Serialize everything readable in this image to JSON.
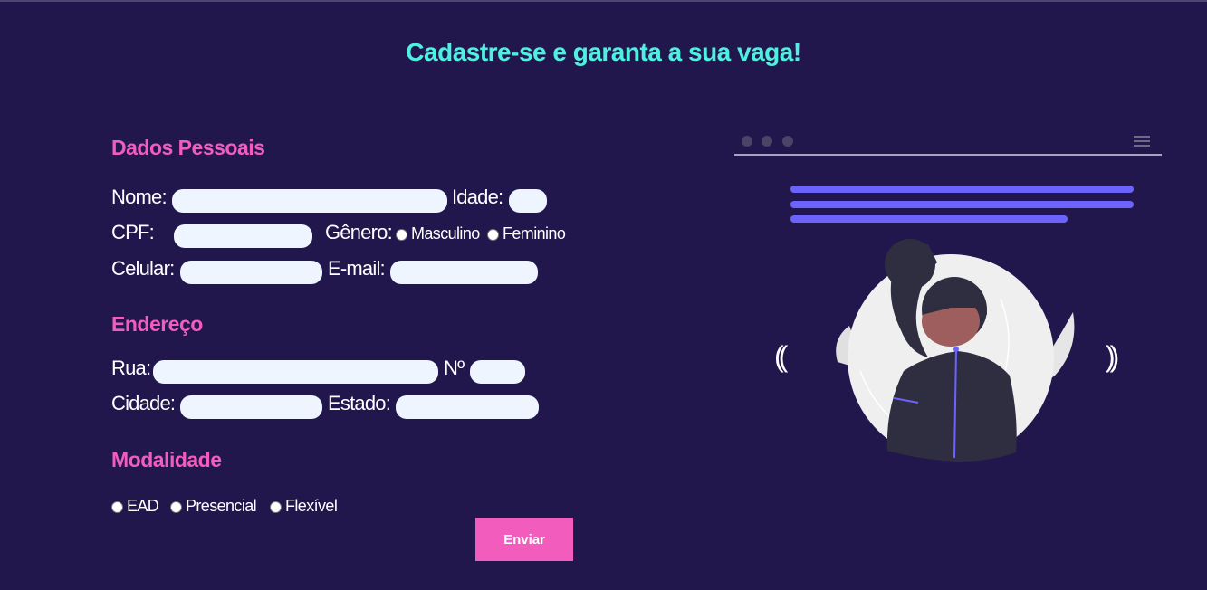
{
  "header": {
    "title": "Cadastre-se e garanta a sua vaga!"
  },
  "sections": {
    "personal": "Dados Pessoais",
    "address": "Endereço",
    "modality": "Modalidade"
  },
  "labels": {
    "nome": "Nome:",
    "idade": "Idade:",
    "cpf": "CPF:",
    "genero": "Gênero:",
    "celular": "Celular:",
    "email": "E-mail:",
    "rua": "Rua:",
    "numero": "Nº",
    "cidade": "Cidade:",
    "estado": "Estado:"
  },
  "gender_options": [
    "Masculino",
    "Feminino"
  ],
  "modality_options": [
    "EAD",
    "Presencial",
    "Flexível"
  ],
  "submit": "Enviar",
  "carousel": {
    "prev": "((",
    "next": "))"
  },
  "colors": {
    "background": "#21174d",
    "accent_cyan": "#4ef0e0",
    "accent_pink": "#f25cbd",
    "field": "#eef5ff",
    "purple": "#6c63ff"
  }
}
